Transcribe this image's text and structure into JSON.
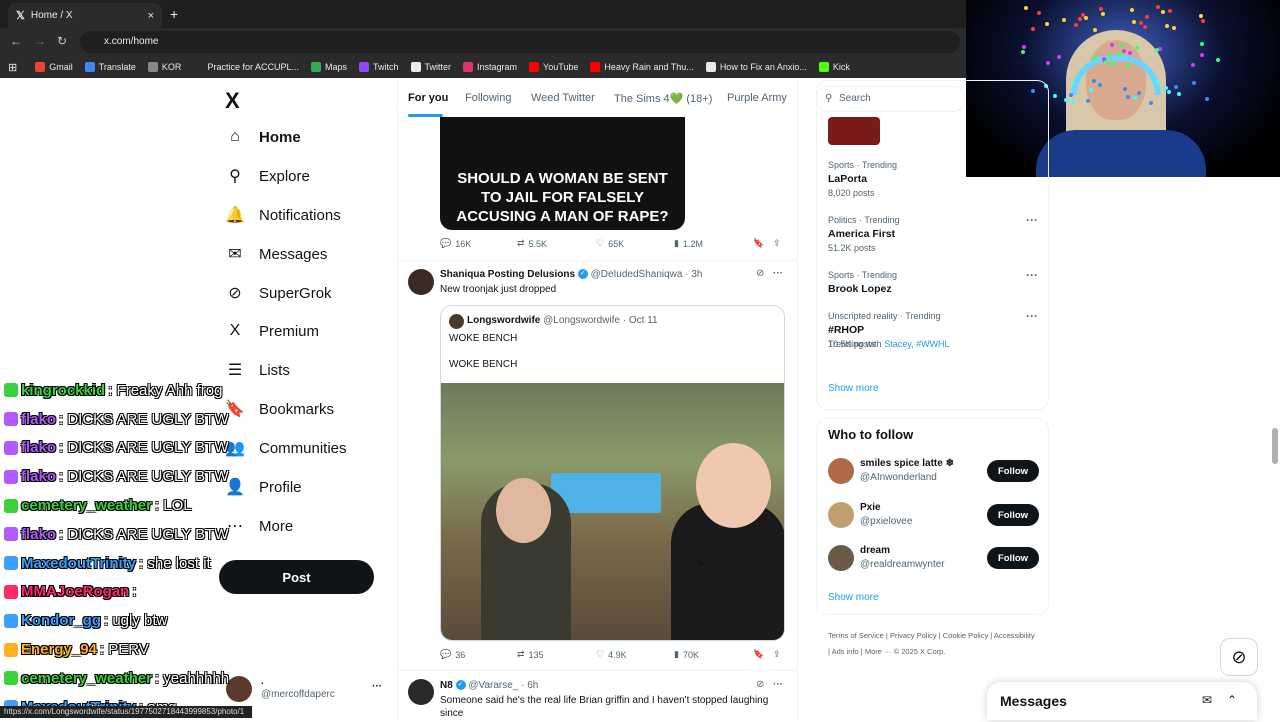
{
  "browser": {
    "tab_title": "Home / X",
    "tab_close": "×",
    "new_tab": "+",
    "url": "x.com/home",
    "bookmarks": [
      {
        "label": "Gmail",
        "color": "#ea4335"
      },
      {
        "label": "Translate",
        "color": "#4285f4"
      },
      {
        "label": "KOR",
        "color": "#888888"
      },
      {
        "label": "Practice for ACCUPL...",
        "color": "#2b2b2b"
      },
      {
        "label": "Maps",
        "color": "#34a853"
      },
      {
        "label": "Twitch",
        "color": "#9146ff"
      },
      {
        "label": "Twitter",
        "color": "#e8eaed"
      },
      {
        "label": "Instagram",
        "color": "#e1306c"
      },
      {
        "label": "YouTube",
        "color": "#ff0000"
      },
      {
        "label": "Heavy Rain and Thu...",
        "color": "#ff0000"
      },
      {
        "label": "How to Fix an Anxio...",
        "color": "#e8eaed"
      },
      {
        "label": "Kick",
        "color": "#53fc18"
      }
    ],
    "status_url": "https://x.com/Longswordwife/status/1977502718443999853/photo/1"
  },
  "sidebar": {
    "logo": "X",
    "items": [
      {
        "label": "Home",
        "icon": "home-icon",
        "glyph": "⌂"
      },
      {
        "label": "Explore",
        "icon": "search-icon",
        "glyph": "⚲"
      },
      {
        "label": "Notifications",
        "icon": "bell-icon",
        "glyph": "🔔"
      },
      {
        "label": "Messages",
        "icon": "mail-icon",
        "glyph": "✉"
      },
      {
        "label": "SuperGrok",
        "icon": "grok-icon",
        "glyph": "⊘"
      },
      {
        "label": "Premium",
        "icon": "x-icon",
        "glyph": "X"
      },
      {
        "label": "Lists",
        "icon": "list-icon",
        "glyph": "☰"
      },
      {
        "label": "Bookmarks",
        "icon": "bookmark-icon",
        "glyph": "🔖"
      },
      {
        "label": "Communities",
        "icon": "communities-icon",
        "glyph": "👥"
      },
      {
        "label": "Profile",
        "icon": "profile-icon",
        "glyph": "👤"
      },
      {
        "label": "More",
        "icon": "more-icon",
        "glyph": "⋯"
      }
    ],
    "post_label": "Post",
    "account_name": ".",
    "account_handle": "@mercoffdaperc",
    "account_dots": "···"
  },
  "chat": [
    {
      "user": "kingrockkid",
      "color": "#3ad13a",
      "msg": ": Freaky Ahh frog"
    },
    {
      "user": "flako",
      "color": "#b05aff",
      "msg": ": DICKS ARE UGLY BTW"
    },
    {
      "user": "flako",
      "color": "#b05aff",
      "msg": ": DICKS ARE UGLY BTW"
    },
    {
      "user": "flako",
      "color": "#b05aff",
      "msg": ": DICKS ARE UGLY BTW"
    },
    {
      "user": "cemetery_weather",
      "color": "#3ad13a",
      "msg": ": LOL"
    },
    {
      "user": "flako",
      "color": "#b05aff",
      "msg": ": DICKS ARE UGLY BTW"
    },
    {
      "user": "MaxedoutTrinity",
      "color": "#3aa0ff",
      "msg": ": she lost it"
    },
    {
      "user": "MMAJoeRogan",
      "color": "#ff2a6a",
      "msg": ":"
    },
    {
      "user": "Kondor_gg",
      "color": "#3aa0ff",
      "msg": ": ugly btw"
    },
    {
      "user": "Energy_94",
      "color": "#ffb020",
      "msg": ": PERV"
    },
    {
      "user": "cemetery_weather",
      "color": "#3ad13a",
      "msg": ": yeahhhhh"
    },
    {
      "user": "MaxedoutTrinity",
      "color": "#3aa0ff",
      "msg": ": omg"
    }
  ],
  "feed": {
    "tabs": [
      "For you",
      "Following",
      "Weed Twitter",
      "The Sims 4💚 (18+)",
      "Purple Army"
    ],
    "tweet1": {
      "image_text": "SHOULD A WOMAN BE SENT TO JAIL FOR FALSELY ACCUSING A MAN OF RAPE?",
      "replies": "16K",
      "reposts": "5.5K",
      "likes": "65K",
      "views": "1.2M"
    },
    "tweet2": {
      "name": "Shaniqua Posting Delusions",
      "handle": "@DeIudedShaniqwa",
      "time": "· 3h",
      "text": "New troonjak just dropped",
      "quote_name": "Longswordwife",
      "quote_handle": "@Longswordwife · Oct 11",
      "quote_line1": "WOKE BENCH",
      "quote_line2": "WOKE BENCH",
      "replies": "36",
      "reposts": "135",
      "likes": "4.9K",
      "views": "70K"
    },
    "tweet3": {
      "name": "N8",
      "handle": "@Vararse_",
      "time": "· 6h",
      "text": "Someone said he's the real life Brian griffin and I haven't stopped laughing",
      "text2": "since"
    }
  },
  "right": {
    "search_placeholder": "Search",
    "trends": [
      {
        "meta": "Sports · Trending",
        "title": "LaPorta",
        "posts": "8,020 posts"
      },
      {
        "meta": "Politics · Trending",
        "title": "America First",
        "posts": "51.2K posts"
      },
      {
        "meta": "Sports · Trending",
        "title": "Brook Lopez",
        "posts": ""
      },
      {
        "meta": "Unscripted reality · Trending",
        "title": "#RHOP",
        "posts": "10.5K posts"
      }
    ],
    "trending_with_label": "Trending with",
    "trending_with_links": "Stacey, #WWHL",
    "show_more": "Show more",
    "who_to_follow": "Who to follow",
    "follow_label": "Follow",
    "follows": [
      {
        "name": "smiles spice latte ❄",
        "handle": "@AInwonderland",
        "color": "#b06a4a"
      },
      {
        "name": "Pxie",
        "handle": "@pxielovee",
        "color": "#c0a070"
      },
      {
        "name": "dream",
        "handle": "@realdreamwynter",
        "color": "#6a5a4a"
      }
    ],
    "footer": "Terms of Service | Privacy Policy | Cookie Policy | Accessibility | Ads info | More ··· © 2025 X Corp.",
    "messages_label": "Messages"
  }
}
